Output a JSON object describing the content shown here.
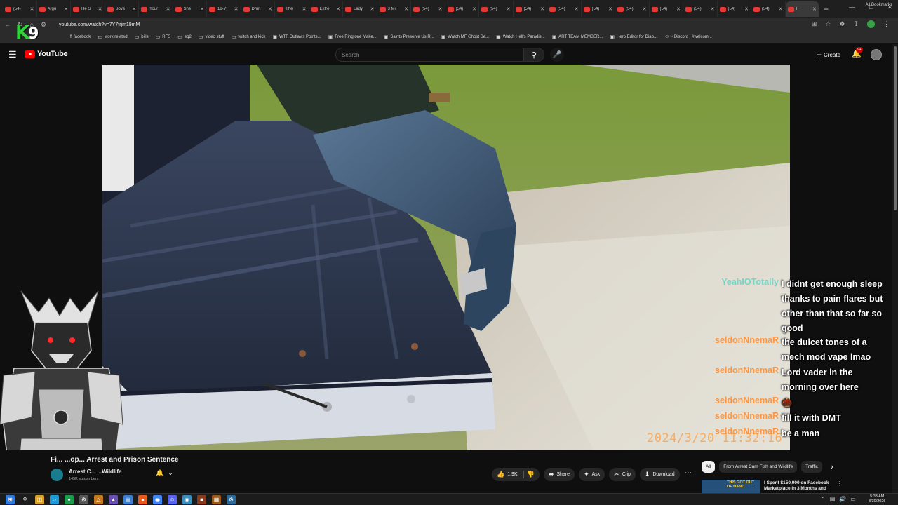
{
  "browser": {
    "tabs": [
      {
        "label": "(54)"
      },
      {
        "label": "Argu"
      },
      {
        "label": "He S"
      },
      {
        "label": "Sove"
      },
      {
        "label": "Your"
      },
      {
        "label": "She"
      },
      {
        "label": "18-Y"
      },
      {
        "label": "Drun"
      },
      {
        "label": "The"
      },
      {
        "label": "Extre"
      },
      {
        "label": "Lady"
      },
      {
        "label": "3 Mi"
      },
      {
        "label": "(54)"
      },
      {
        "label": "(54)"
      },
      {
        "label": "(54)"
      },
      {
        "label": "(54)"
      },
      {
        "label": "(54)"
      },
      {
        "label": "(54)"
      },
      {
        "label": "(54)"
      },
      {
        "label": "(54)"
      },
      {
        "label": "(54)"
      },
      {
        "label": "(54)"
      },
      {
        "label": "(54)"
      },
      {
        "label": "F"
      }
    ],
    "url": "youtube.com/watch?v=7Y7trjm19mM",
    "bookmarks": [
      {
        "label": "facebook",
        "icon": "facebook-icon"
      },
      {
        "label": "work related",
        "icon": "folder-icon"
      },
      {
        "label": "bills",
        "icon": "folder-icon"
      },
      {
        "label": "RFS",
        "icon": "folder-icon"
      },
      {
        "label": "eq2",
        "icon": "folder-icon"
      },
      {
        "label": "video stuff",
        "icon": "folder-icon"
      },
      {
        "label": "twitch and kick",
        "icon": "folder-icon"
      },
      {
        "label": "WTF Outlaws Points...",
        "icon": "site-icon"
      },
      {
        "label": "Free Ringtone Make...",
        "icon": "site-icon"
      },
      {
        "label": "Saints Preserve Us R...",
        "icon": "site-icon"
      },
      {
        "label": "Watch MF Ghost Se...",
        "icon": "site-icon"
      },
      {
        "label": "Watch Hell's Paradis...",
        "icon": "site-icon"
      },
      {
        "label": "ART TEAM MEMBER...",
        "icon": "site-icon"
      },
      {
        "label": "Hero Editor for Diab...",
        "icon": "site-icon"
      },
      {
        "label": "• Discord | #welcom...",
        "icon": "discord-icon"
      }
    ],
    "all_bookmarks": "All Bookmarks"
  },
  "overlay": {
    "k9_k": "K",
    "k9_nine": "9",
    "video_timestamp": "2024/3/20 11:32:16"
  },
  "youtube": {
    "logo": "YouTube",
    "search_placeholder": "Search",
    "create_label": "Create",
    "notif_badge": "9+"
  },
  "chat": [
    {
      "user": "YeahIOTotally",
      "user_color": "#5fd6c4",
      "lines": [
        "I didnt get enough sleep",
        "thanks to pain flares but",
        "other than that so far so",
        "good"
      ]
    },
    {
      "user": "seldonNnemaR",
      "user_color": "#ff8a2a",
      "lines": [
        "the dulcet tones of a",
        "mech mod vape lmao"
      ]
    },
    {
      "user": "seldonNnemaR",
      "user_color": "#ff8a2a",
      "lines": [
        "Lord vader in the",
        "morning over here"
      ]
    },
    {
      "user": "seldonNnemaR",
      "user_color": "#ff8a2a",
      "lines": [
        "🌰"
      ]
    },
    {
      "user": "seldonNnemaR",
      "user_color": "#ff8a2a",
      "lines": [
        "fill it with DMT"
      ]
    },
    {
      "user": "seldonNnemaR",
      "user_color": "#ff8a2a",
      "lines": [
        "be a man"
      ]
    }
  ],
  "video": {
    "title": "Fi... ...op... Arrest and Prison Sentence",
    "channel": "Arrest C... ...Wildlife",
    "subscribers": "145K subscribers",
    "like_count": "1.9K",
    "actions": {
      "share": "Share",
      "ask": "Ask",
      "clip": "Clip",
      "download": "Download"
    }
  },
  "sidebar": {
    "chips": [
      {
        "label": "All",
        "active": true
      },
      {
        "label": "From Arrest Cam Fish and Wildlife",
        "active": false
      },
      {
        "label": "Traffic",
        "active": false
      }
    ],
    "reco": {
      "thumb_text": "THIS GOT OUT OF HAND",
      "title": "I Spent $150,000 on Facebook Marketplace in 3 Months and"
    }
  },
  "taskbar": {
    "time": "5:33 AM",
    "date": "3/30/2026"
  },
  "colors": {
    "accent": "#ff0000",
    "bg": "#0f0f0f"
  }
}
